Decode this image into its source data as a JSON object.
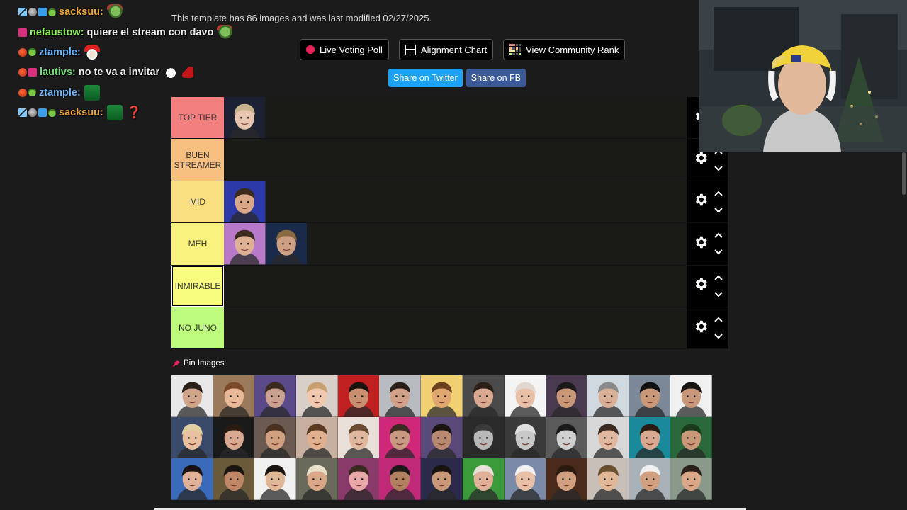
{
  "chat": [
    {
      "badges": [
        "sword",
        "grey",
        "cube",
        "frog"
      ],
      "user": "sacksuu",
      "user_color": "#f0a53c",
      "message": "",
      "emotes": [
        "pepe"
      ]
    },
    {
      "badges": [
        "twitch"
      ],
      "user": "nefaustow",
      "user_color": "#8af05a",
      "message": "quiere el stream con davo",
      "emotes": [
        "pepe"
      ]
    },
    {
      "badges": [
        "red",
        "frog"
      ],
      "user": "ztample",
      "user_color": "#6bb6ff",
      "message": "",
      "emotes": [
        "santa"
      ]
    },
    {
      "badges": [
        "red",
        "twitch"
      ],
      "user": "lautivs",
      "user_color": "#6fe06f",
      "message": "no te va a invitar",
      "emotes": [
        "snow",
        "hat"
      ]
    },
    {
      "badges": [
        "red",
        "frog"
      ],
      "user": "ztample",
      "user_color": "#6bb6ff",
      "message": "",
      "emotes": [
        "frogbox"
      ]
    },
    {
      "badges": [
        "sword",
        "grey",
        "cube",
        "frog"
      ],
      "user": "sacksuu",
      "user_color": "#f0a53c",
      "message": "",
      "emotes": [
        "frogbox",
        "question"
      ]
    }
  ],
  "template_info": "This template has 86 images and was last modified 02/27/2025.",
  "buttons": {
    "live_poll": "Live Voting Poll",
    "alignment": "Alignment Chart",
    "community": "View Community Rank",
    "share_twitter": "Share on Twitter",
    "share_fb": "Share on FB"
  },
  "tiers": [
    {
      "label": "TOP TIER",
      "color": "#f47f7f",
      "items": [
        {
          "bg": "#1c2233",
          "skin": "#e8c5b0",
          "hair": "#c9b38c"
        }
      ]
    },
    {
      "label": "BUEN STREAMER",
      "color": "#f7bf80",
      "items": []
    },
    {
      "label": "MID",
      "color": "#f9df80",
      "items": [
        {
          "bg": "#2b3aa8",
          "skin": "#d9a888",
          "hair": "#3b2a1e"
        }
      ]
    },
    {
      "label": "MEH",
      "color": "#f9f27e",
      "items": [
        {
          "bg": "#b87ac8",
          "skin": "#deb194",
          "hair": "#3a2a20"
        },
        {
          "bg": "#1a2a4a",
          "skin": "#cda084",
          "hair": "#8a6a40"
        }
      ]
    },
    {
      "label": "INMIRABLE",
      "color": "#f8fd7f",
      "items": []
    },
    {
      "label": "NO JUNO",
      "color": "#befc7e",
      "items": []
    }
  ],
  "selected_tier": 4,
  "pin_label": "Pin Images",
  "bank": [
    {
      "bg": "#e8e8e8",
      "skin": "#cfa58a",
      "hair": "#2a1f18"
    },
    {
      "bg": "#9a7a5a",
      "skin": "#e8b898",
      "hair": "#7a4a2a"
    },
    {
      "bg": "#5a4a8a",
      "skin": "#caa090",
      "hair": "#3a2a20"
    },
    {
      "bg": "#d8d0c8",
      "skin": "#f0c8b0",
      "hair": "#c8a070"
    },
    {
      "bg": "#c02020",
      "skin": "#c89070",
      "hair": "#1a1410"
    },
    {
      "bg": "#b8bcc0",
      "skin": "#d0a088",
      "hair": "#2a201a"
    },
    {
      "bg": "#f0d070",
      "skin": "#e0a870",
      "hair": "#6a4020"
    },
    {
      "bg": "#4a4a4a",
      "skin": "#d8a890",
      "hair": "#2a2018"
    },
    {
      "bg": "#f4f4f4",
      "skin": "#e8c0a8",
      "hair": "#e0d8d0"
    },
    {
      "bg": "#4a3a50",
      "skin": "#c89878",
      "hair": "#1a1a1a"
    },
    {
      "bg": "#d0d8e0",
      "skin": "#d8b098",
      "hair": "#8a8a8a"
    },
    {
      "bg": "#7a8898",
      "skin": "#c89878",
      "hair": "#101010"
    },
    {
      "bg": "#f0f0f0",
      "skin": "#c8987a",
      "hair": "#1a1410"
    },
    {
      "bg": "#3a4a6a",
      "skin": "#e8c0a0",
      "hair": "#e0d0a0"
    },
    {
      "bg": "#1a1a1a",
      "skin": "#d8a890",
      "hair": "#2a1a10"
    },
    {
      "bg": "#6a5a50",
      "skin": "#d0a080",
      "hair": "#4a3020"
    },
    {
      "bg": "#c8b0a0",
      "skin": "#e0b090",
      "hair": "#5a3a20"
    },
    {
      "bg": "#e8e0d8",
      "skin": "#e0b8a0",
      "hair": "#6a4a30"
    },
    {
      "bg": "#d02878",
      "skin": "#c89880",
      "hair": "#3a2a20"
    },
    {
      "bg": "#5a4a7a",
      "skin": "#b88870",
      "hair": "#1a1410"
    },
    {
      "bg": "#2a2a2a",
      "skin": "#b8b8b8",
      "hair": "#3a3a3a"
    },
    {
      "bg": "#3a3a3a",
      "skin": "#c8c8c8",
      "hair": "#e0e0e0"
    },
    {
      "bg": "#5a5a5a",
      "skin": "#d0d0d0",
      "hair": "#1a1a1a"
    },
    {
      "bg": "#d8d8d8",
      "skin": "#e0b8a0",
      "hair": "#3a2a20"
    },
    {
      "bg": "#1a8a9a",
      "skin": "#d8a890",
      "hair": "#2a1a10"
    },
    {
      "bg": "#2a6a3a",
      "skin": "#c89878",
      "hair": "#1a3a1a"
    },
    {
      "bg": "#3a6aba",
      "skin": "#e0b098",
      "hair": "#1a1410"
    },
    {
      "bg": "#6a5a3a",
      "skin": "#c08868",
      "hair": "#1a1410"
    },
    {
      "bg": "#f0f0f0",
      "skin": "#e0b898",
      "hair": "#1a1410"
    },
    {
      "bg": "#6a6a5a",
      "skin": "#d8a888",
      "hair": "#e8e0c8"
    },
    {
      "bg": "#8a3a6a",
      "skin": "#e8a8a8",
      "hair": "#3a2a20"
    },
    {
      "bg": "#c02878",
      "skin": "#b08060",
      "hair": "#1a1a1a"
    },
    {
      "bg": "#2a2a4a",
      "skin": "#c89878",
      "hair": "#1a1410"
    },
    {
      "bg": "#3a9a3a",
      "skin": "#e0b098",
      "hair": "#e8e0d8"
    },
    {
      "bg": "#7a8aa8",
      "skin": "#e8c0a8",
      "hair": "#f0f0f0"
    },
    {
      "bg": "#4a2a1a",
      "skin": "#d0a080",
      "hair": "#2a1a10"
    },
    {
      "bg": "#c8c0b8",
      "skin": "#e0b898",
      "hair": "#6a5030"
    },
    {
      "bg": "#a8b0b8",
      "skin": "#d0a080",
      "hair": "#f0f0f0"
    },
    {
      "bg": "#8a9a8a",
      "skin": "#d8a888",
      "hair": "#2a2018"
    }
  ],
  "webcam": {
    "bg": "#2c3338",
    "hat": "#f2d23a",
    "skin": "#e2b89a",
    "headphones": "#f2f2f2",
    "shirt": "#c8c8c8"
  }
}
